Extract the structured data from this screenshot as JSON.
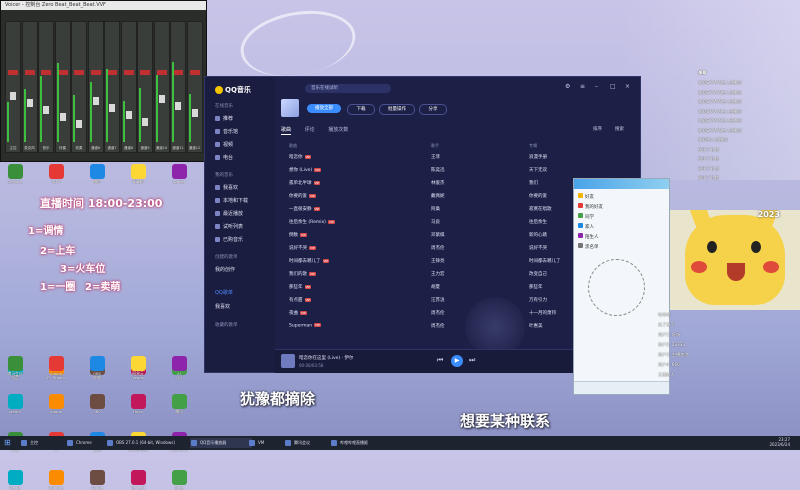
{
  "mixer": {
    "title": "Voicer - 控制台 Zero Beat_Beat_Beat.VVF",
    "strip_labels": [
      "主控",
      "麦克风",
      "音乐",
      "伴奏",
      "效果",
      "通道6",
      "通道7",
      "通道8",
      "通道9",
      "通道10",
      "通道11",
      "通道12"
    ]
  },
  "overlay": {
    "schedule": "直播时间 18:00-23:00",
    "line1": "1=调情",
    "line2": "2=上车",
    "line3": "3=火车位",
    "line4": "1=一圈",
    "line5": "2=卖萌"
  },
  "desktop_icons": [
    "GeForce",
    "IQIYI",
    "微信",
    "计算机",
    "Gamer",
    "抖音",
    "FL Studio",
    "哔哩",
    "Vegas",
    "QQ",
    "腾讯会议",
    "Adobe",
    "OBS",
    "网易云",
    "Ai",
    "steam",
    "Adobe",
    "360",
    "Hoyo",
    "腾讯",
    "酷狗",
    "YY",
    "剪映",
    "ScreenRec",
    "WeGame",
    "Media",
    "Chrome",
    "Adobe",
    "Tencent",
    "Edge"
  ],
  "qq_music": {
    "logo": "QQ音乐",
    "search_placeholder": "音乐在线试听",
    "sidebar": {
      "section_online": "在线音乐",
      "items_online": [
        "推荐",
        "音乐馆",
        "视频",
        "电台"
      ],
      "section_mine": "我的音乐",
      "items_mine": [
        "我喜欢",
        "本地和下载",
        "最近播放",
        "试听列表",
        "已购音乐"
      ],
      "section_created": "创建的歌单",
      "items_created": [
        "我的创作",
        "QQ歌单",
        "我喜欢"
      ],
      "section_collected": "收藏的歌单"
    },
    "actions": [
      "播放全部",
      "下载",
      "批量操作",
      "分享"
    ],
    "tabs": [
      "歌曲",
      "评论",
      "播放次数"
    ],
    "tab_right": [
      "排序",
      "搜索"
    ],
    "columns": [
      "歌曲",
      "歌手",
      "专辑"
    ],
    "rows": [
      {
        "title": "暗恋你",
        "artist": "王菲",
        "album": "浪漫手册"
      },
      {
        "title": "想你 (Live)",
        "artist": "陈奕迅",
        "album": "天下无双"
      },
      {
        "title": "孤单北半球",
        "artist": "林俊杰",
        "album": "我们"
      },
      {
        "title": "你要的爱",
        "artist": "戴佩妮",
        "album": "你要的爱"
      },
      {
        "title": "一直很安静",
        "artist": "阿桑",
        "album": "寂寞在唱歌"
      },
      {
        "title": "往后余生 (Remix)",
        "artist": "马良",
        "album": "往后余生"
      },
      {
        "title": "倒数",
        "artist": "邓紫棋",
        "album": "新的心跳"
      },
      {
        "title": "说好不哭",
        "artist": "周杰伦",
        "album": "说好不哭"
      },
      {
        "title": "时间都去哪儿了",
        "artist": "王铮亮",
        "album": "时间都去哪儿了"
      },
      {
        "title": "我们的歌",
        "artist": "王力宏",
        "album": "改变自己"
      },
      {
        "title": "那些年",
        "artist": "胡夏",
        "album": "那些年"
      },
      {
        "title": "有点甜",
        "artist": "汪苏泷",
        "album": "万有引力"
      },
      {
        "title": "夜曲",
        "artist": "周杰伦",
        "album": "十一月的萧邦"
      },
      {
        "title": "Superman",
        "artist": "周杰伦",
        "album": "叶惠美"
      }
    ],
    "player": {
      "title": "暗恋你在这里 (Live) · 伊尔",
      "time": "00:00/03:58"
    }
  },
  "chat_panel": {
    "header": "弹幕",
    "lines": [
      "欢迎EXYAM进入直播间",
      "欢迎EXYAM进入直播间",
      "欢迎EXYAM进入直播间",
      "欢迎EXYAM进入直播间",
      "欢迎EXYAM进入直播间",
      "欢迎EXYAM进入直播间",
      "欢迎进入直播间",
      "送出了礼物",
      "送出了礼物",
      "送出了礼物",
      "送出了礼物"
    ]
  },
  "buddy": {
    "groups": [
      "好友",
      "我的好友",
      "同学",
      "家人",
      "陌生人",
      "黑名单"
    ]
  },
  "cam": {
    "stamp": "2023"
  },
  "comments": [
    "哈哈哈",
    "来了来了",
    "用户1: 好听",
    "用户2: 23333",
    "用户3: 主播加油",
    "用户4: 666",
    "主播好人"
  ],
  "subtitles": {
    "left": "犹豫都摘除",
    "right": "想要某种联系"
  },
  "taskbar": {
    "items": [
      "主控",
      "Chrome",
      "OBS 27.0.1 (64-bit, Windows)",
      "QQ音乐播放器",
      "VM",
      "腾讯会议",
      "哔哩哔哩直播姬"
    ],
    "clock_time": "23:27",
    "clock_date": "2023/6/24"
  }
}
